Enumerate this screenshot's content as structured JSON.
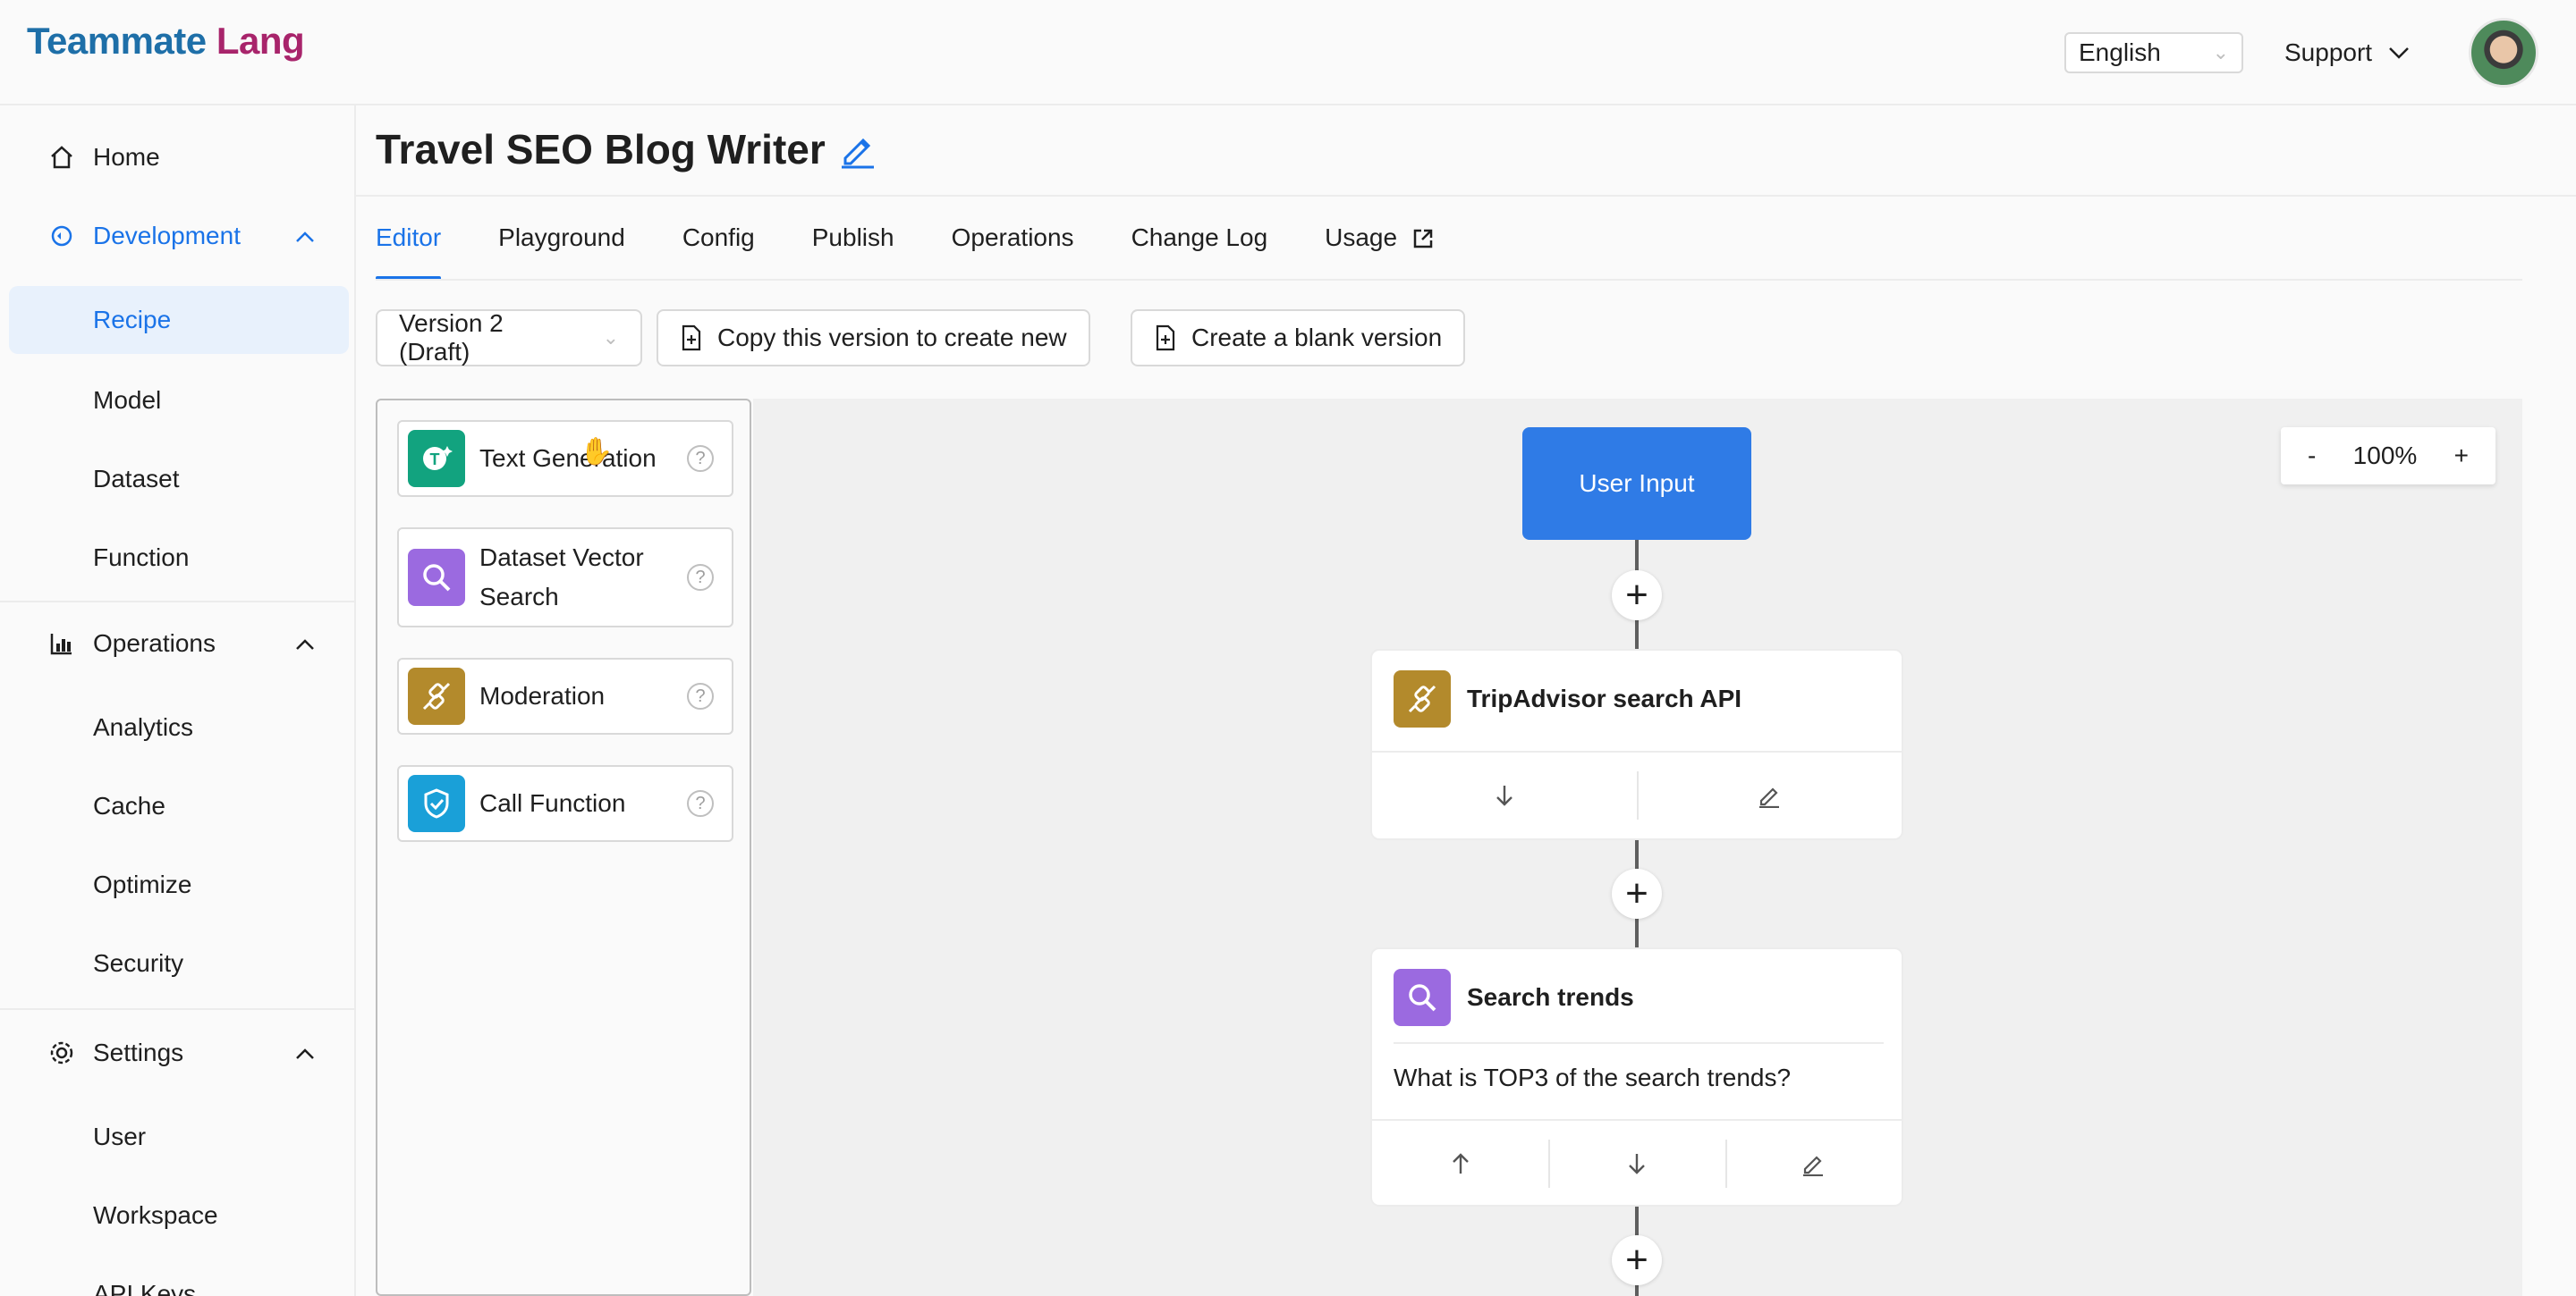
{
  "header": {
    "logo_part1": "Teammate",
    "logo_part2": "Lang",
    "language": "English",
    "support_label": "Support"
  },
  "sidebar": {
    "home": "Home",
    "development": "Development",
    "dev_items": [
      "Recipe",
      "Model",
      "Dataset",
      "Function"
    ],
    "operations": "Operations",
    "ops_items": [
      "Analytics",
      "Cache",
      "Optimize",
      "Security"
    ],
    "settings": "Settings",
    "settings_items": [
      "User",
      "Workspace",
      "API Keys"
    ]
  },
  "page": {
    "title": "Travel SEO Blog Writer",
    "tabs": [
      "Editor",
      "Playground",
      "Config",
      "Publish",
      "Operations",
      "Change Log",
      "Usage"
    ],
    "active_tab": "Editor"
  },
  "toolbar": {
    "version": "Version 2 (Draft)",
    "copy_label": "Copy this version to create new",
    "blank_label": "Create a blank version"
  },
  "palette": {
    "items": [
      {
        "label": "Text Generation",
        "icon": "text-generation-icon",
        "color": "#12a37f"
      },
      {
        "label": "Dataset Vector Search",
        "icon": "search-icon",
        "color": "#9b6ae0"
      },
      {
        "label": "Moderation",
        "icon": "plug-icon",
        "color": "#b38a2c"
      },
      {
        "label": "Call Function",
        "icon": "shield-icon",
        "color": "#1aa0d8"
      }
    ]
  },
  "canvas": {
    "zoom_minus": "-",
    "zoom_level": "100%",
    "zoom_plus": "+",
    "user_input": "User Input",
    "nodes": [
      {
        "title": "TripAdvisor search API",
        "icon": "plug-icon",
        "color": "#b38a2c"
      },
      {
        "title": "Search trends",
        "icon": "search-icon",
        "color": "#9b6ae0",
        "body": "What is TOP3 of the search trends?"
      }
    ]
  },
  "colors": {
    "accent": "#1a73e8",
    "user_input_bg": "#2f7be6"
  }
}
